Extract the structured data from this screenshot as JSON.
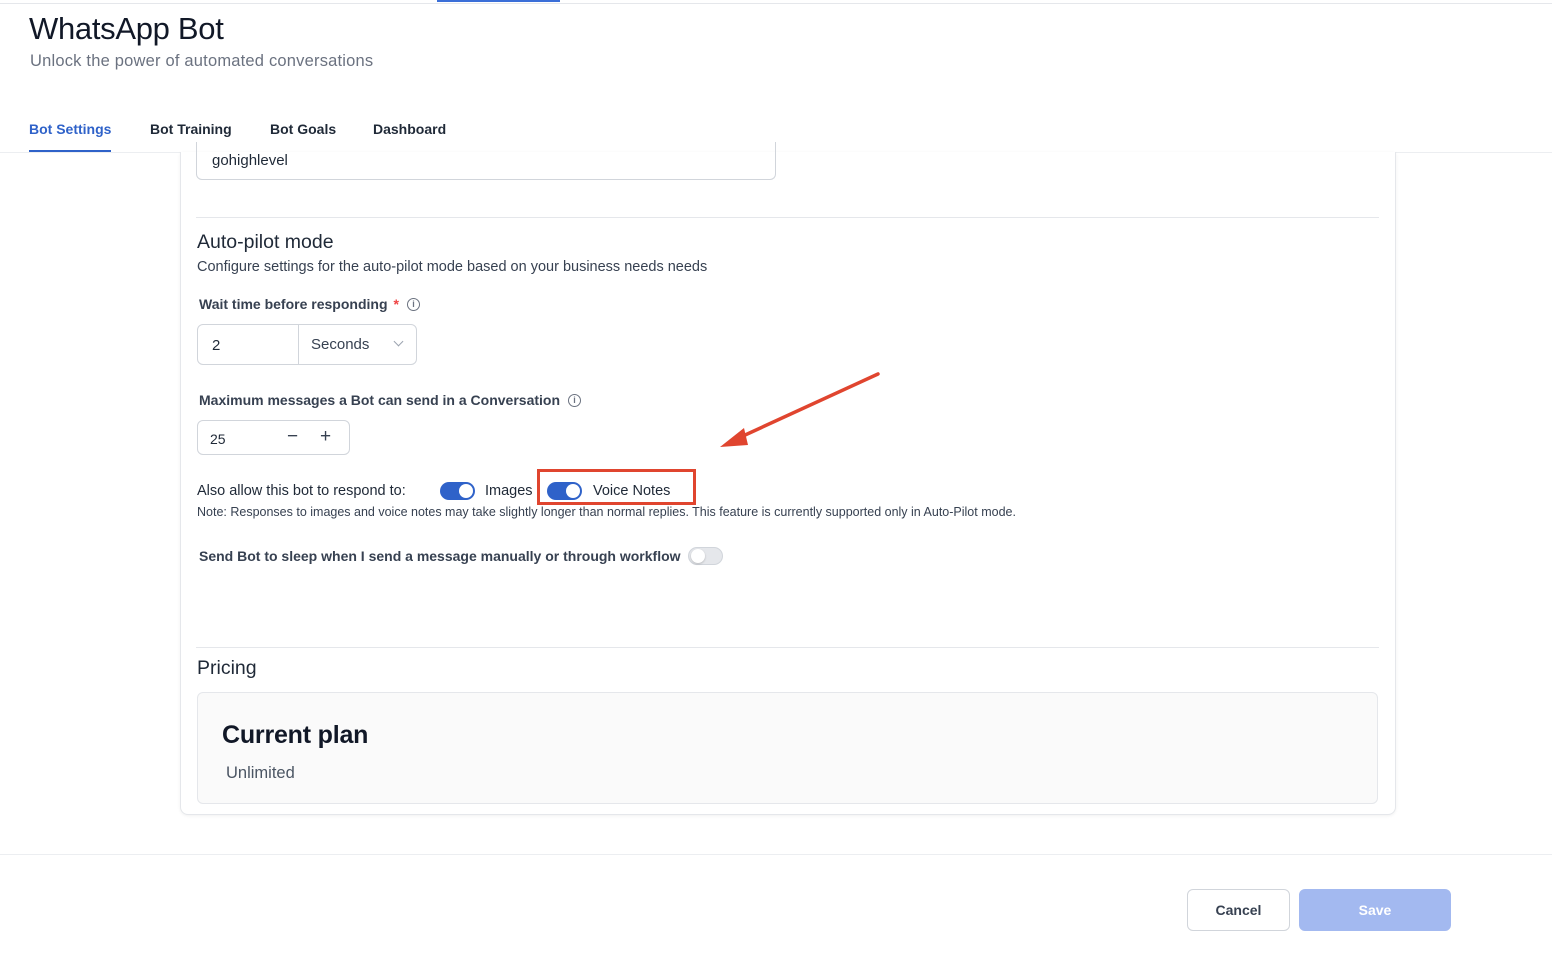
{
  "header": {
    "title": "WhatsApp Bot",
    "subtitle": "Unlock the power of automated conversations"
  },
  "tabs": [
    {
      "label": "Bot Settings",
      "active": true
    },
    {
      "label": "Bot Training",
      "active": false
    },
    {
      "label": "Bot Goals",
      "active": false
    },
    {
      "label": "Dashboard",
      "active": false
    }
  ],
  "settings": {
    "name_value": "gohighlevel",
    "autopilot": {
      "title": "Auto-pilot mode",
      "description": "Configure settings for the auto-pilot mode based on your business needs needs",
      "wait_label": "Wait time before responding",
      "wait_required_mark": "*",
      "wait_value": "2",
      "wait_unit": "Seconds",
      "max_label": "Maximum messages a Bot can send in a Conversation",
      "max_value": "25",
      "stepper_minus": "−",
      "stepper_plus": "+",
      "respond_label": "Also allow this bot to respond to:",
      "images_label": "Images",
      "images_enabled": true,
      "voice_label": "Voice Notes",
      "voice_enabled": true,
      "note": "Note: Responses to images and voice notes may take slightly longer than normal replies. This feature is currently supported only in Auto-Pilot mode.",
      "sleep_label": "Send Bot to sleep when I send a message manually or through workflow",
      "sleep_enabled": false
    },
    "pricing": {
      "title": "Pricing",
      "plan_title": "Current plan",
      "plan_value": "Unlimited"
    }
  },
  "footer": {
    "cancel_label": "Cancel",
    "save_label": "Save"
  },
  "colors": {
    "accent": "#2f62c9",
    "annotation": "#e0452f",
    "save_disabled": "#a3b9f0"
  },
  "icons": {
    "info": "info-icon",
    "chevron": "chevron-down-icon",
    "annotation_arrow": "arrow-icon"
  }
}
